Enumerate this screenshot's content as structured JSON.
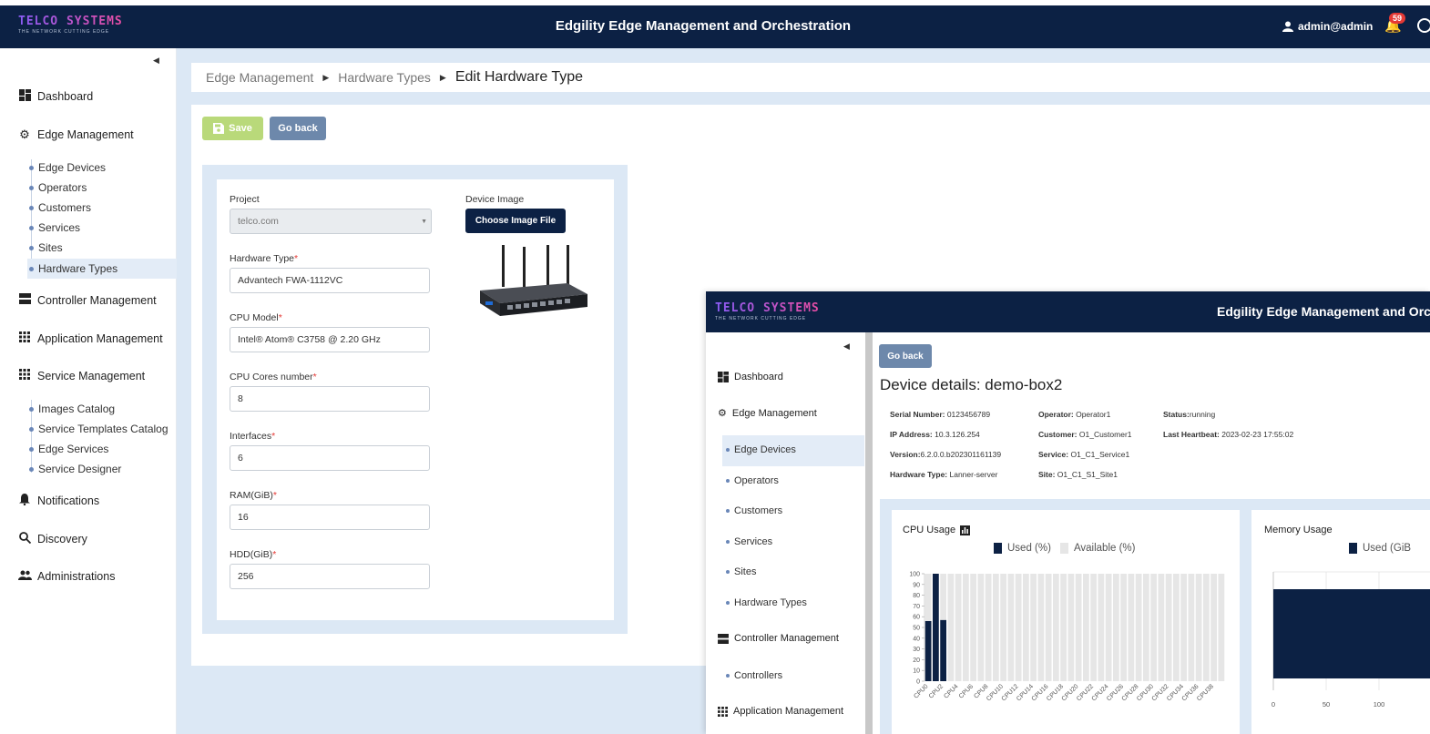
{
  "app": {
    "logo_main": "TELCO SYSTEMS",
    "logo_sub": "THE NETWORK CUTTING EDGE",
    "title": "Edgility Edge Management and Orchestration",
    "user": "admin@admin",
    "notifications_count": "59"
  },
  "sidebar": {
    "sections": [
      {
        "label": "Dashboard"
      },
      {
        "label": "Edge Management"
      },
      {
        "label": "Controller Management"
      },
      {
        "label": "Application Management"
      },
      {
        "label": "Service Management"
      },
      {
        "label": "Notifications"
      },
      {
        "label": "Discovery"
      },
      {
        "label": "Administrations"
      }
    ],
    "edge_items": [
      "Edge Devices",
      "Operators",
      "Customers",
      "Services",
      "Sites",
      "Hardware Types"
    ],
    "service_items": [
      "Images Catalog",
      "Service Templates Catalog",
      "Edge Services",
      "Service Designer"
    ],
    "active_item": "Hardware Types"
  },
  "breadcrumb": {
    "items": [
      "Edge Management",
      "Hardware Types"
    ],
    "current": "Edit Hardware Type"
  },
  "toolbar": {
    "save_label": "Save",
    "back_label": "Go back"
  },
  "form": {
    "project_label": "Project",
    "project_value": "telco.com",
    "device_image_label": "Device Image",
    "choose_image_label": "Choose Image File",
    "hardware_type_label": "Hardware Type",
    "hardware_type_value": "Advantech FWA-1112VC",
    "cpu_model_label": "CPU Model",
    "cpu_model_value": "Intel® Atom® C3758 @ 2.20 GHz",
    "cpu_cores_label": "CPU Cores number",
    "cpu_cores_value": "8",
    "interfaces_label": "Interfaces",
    "interfaces_value": "6",
    "ram_label": "RAM(GiB)",
    "ram_value": "16",
    "hdd_label": "HDD(GiB)",
    "hdd_value": "256",
    "required_mark": "*"
  },
  "overlay": {
    "title": "Edgility Edge Management and Orche",
    "back_label": "Go back",
    "nav": {
      "dashboard": "Dashboard",
      "edge_management": "Edge Management",
      "edge_items": [
        "Edge Devices",
        "Operators",
        "Customers",
        "Services",
        "Sites",
        "Hardware Types"
      ],
      "controller_management": "Controller Management",
      "controllers": "Controllers",
      "application_management": "Application Management"
    },
    "device_title": "Device details: demo-box2",
    "details": {
      "serial_label": "Serial Number:",
      "serial": " 0123456789",
      "ip_label": "IP Address:",
      "ip": " 10.3.126.254",
      "version_label": "Version:",
      "version": "6.2.0.0.b202301161139",
      "hwtype_label": "Hardware Type:",
      "hwtype": " Lanner-server",
      "operator_label": "Operator:",
      "operator": " Operator1",
      "customer_label": "Customer:",
      "customer": " O1_Customer1",
      "service_label": "Service:",
      "service": " O1_C1_Service1",
      "site_label": "Site:",
      "site": " O1_C1_S1_Site1",
      "status_label": "Status:",
      "status": "running",
      "heartbeat_label": "Last Heartbeat:",
      "heartbeat": " 2023-02-23 17:55:02"
    },
    "cpu_title": "CPU Usage",
    "mem_title": "Memory Usage",
    "mem_legend_used": "Used (GiB"
  },
  "chart_data": [
    {
      "type": "bar",
      "title": "CPU Usage",
      "legend": [
        "Used (%)",
        "Available (%)"
      ],
      "legend_placement": "top-center",
      "ylim": [
        0,
        100
      ],
      "yticks": [
        0,
        10,
        20,
        30,
        40,
        50,
        60,
        70,
        80,
        90,
        100
      ],
      "categories": [
        "CPU0",
        "CPU1",
        "CPU2",
        "CPU3",
        "CPU4",
        "CPU5",
        "CPU6",
        "CPU7",
        "CPU8",
        "CPU9",
        "CPU10",
        "CPU11",
        "CPU12",
        "CPU13",
        "CPU14",
        "CPU15",
        "CPU16",
        "CPU17",
        "CPU18",
        "CPU19",
        "CPU20",
        "CPU21",
        "CPU22",
        "CPU23",
        "CPU24",
        "CPU25",
        "CPU26",
        "CPU27",
        "CPU28",
        "CPU29",
        "CPU30",
        "CPU31",
        "CPU32",
        "CPU33",
        "CPU34",
        "CPU35",
        "CPU36",
        "CPU37",
        "CPU38",
        "CPU39"
      ],
      "tick_labels": [
        "CPU0",
        "CPU2",
        "CPU4",
        "CPU6",
        "CPU8",
        "CPU10",
        "CPU12",
        "CPU14",
        "CPU16",
        "CPU18",
        "CPU20",
        "CPU22",
        "CPU24",
        "CPU26",
        "CPU28",
        "CPU30",
        "CPU32",
        "CPU34",
        "CPU36",
        "CPU38"
      ],
      "stacked": true,
      "series": [
        {
          "name": "Used (%)",
          "color": "#0c2144",
          "values": [
            56,
            100,
            57,
            0,
            0,
            0,
            0,
            0,
            0,
            0,
            0,
            0,
            0,
            0,
            0,
            0,
            0,
            0,
            0,
            0,
            0,
            0,
            0,
            0,
            0,
            0,
            0,
            0,
            0,
            0,
            0,
            0,
            0,
            0,
            0,
            0,
            0,
            0,
            0,
            0
          ]
        },
        {
          "name": "Available (%)",
          "color": "#e6e6e6",
          "values": [
            44,
            0,
            43,
            100,
            100,
            100,
            100,
            100,
            100,
            100,
            100,
            100,
            100,
            100,
            100,
            100,
            100,
            100,
            100,
            100,
            100,
            100,
            100,
            100,
            100,
            100,
            100,
            100,
            100,
            100,
            100,
            100,
            100,
            100,
            100,
            100,
            100,
            100,
            100,
            100
          ]
        }
      ]
    },
    {
      "type": "bar",
      "orientation": "horizontal",
      "title": "Memory Usage",
      "legend": [
        "Used (GiB"
      ],
      "xticks": [
        0,
        50,
        100
      ],
      "series": [
        {
          "name": "Used (GiB",
          "color": "#0c2144",
          "values": [
            180
          ]
        }
      ]
    }
  ]
}
